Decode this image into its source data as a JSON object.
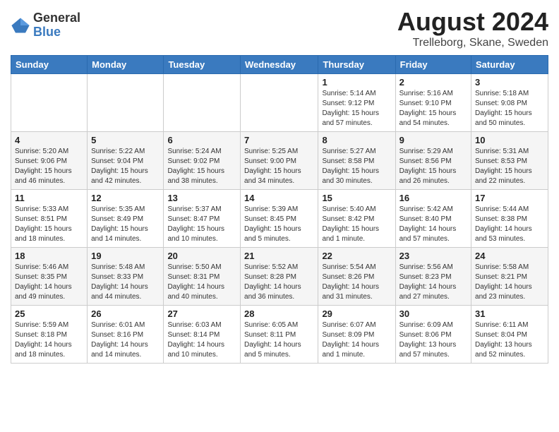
{
  "header": {
    "logo_line1": "General",
    "logo_line2": "Blue",
    "main_title": "August 2024",
    "subtitle": "Trelleborg, Skane, Sweden"
  },
  "calendar": {
    "days_of_week": [
      "Sunday",
      "Monday",
      "Tuesday",
      "Wednesday",
      "Thursday",
      "Friday",
      "Saturday"
    ],
    "weeks": [
      [
        {
          "day": "",
          "info": ""
        },
        {
          "day": "",
          "info": ""
        },
        {
          "day": "",
          "info": ""
        },
        {
          "day": "",
          "info": ""
        },
        {
          "day": "1",
          "info": "Sunrise: 5:14 AM\nSunset: 9:12 PM\nDaylight: 15 hours\nand 57 minutes."
        },
        {
          "day": "2",
          "info": "Sunrise: 5:16 AM\nSunset: 9:10 PM\nDaylight: 15 hours\nand 54 minutes."
        },
        {
          "day": "3",
          "info": "Sunrise: 5:18 AM\nSunset: 9:08 PM\nDaylight: 15 hours\nand 50 minutes."
        }
      ],
      [
        {
          "day": "4",
          "info": "Sunrise: 5:20 AM\nSunset: 9:06 PM\nDaylight: 15 hours\nand 46 minutes."
        },
        {
          "day": "5",
          "info": "Sunrise: 5:22 AM\nSunset: 9:04 PM\nDaylight: 15 hours\nand 42 minutes."
        },
        {
          "day": "6",
          "info": "Sunrise: 5:24 AM\nSunset: 9:02 PM\nDaylight: 15 hours\nand 38 minutes."
        },
        {
          "day": "7",
          "info": "Sunrise: 5:25 AM\nSunset: 9:00 PM\nDaylight: 15 hours\nand 34 minutes."
        },
        {
          "day": "8",
          "info": "Sunrise: 5:27 AM\nSunset: 8:58 PM\nDaylight: 15 hours\nand 30 minutes."
        },
        {
          "day": "9",
          "info": "Sunrise: 5:29 AM\nSunset: 8:56 PM\nDaylight: 15 hours\nand 26 minutes."
        },
        {
          "day": "10",
          "info": "Sunrise: 5:31 AM\nSunset: 8:53 PM\nDaylight: 15 hours\nand 22 minutes."
        }
      ],
      [
        {
          "day": "11",
          "info": "Sunrise: 5:33 AM\nSunset: 8:51 PM\nDaylight: 15 hours\nand 18 minutes."
        },
        {
          "day": "12",
          "info": "Sunrise: 5:35 AM\nSunset: 8:49 PM\nDaylight: 15 hours\nand 14 minutes."
        },
        {
          "day": "13",
          "info": "Sunrise: 5:37 AM\nSunset: 8:47 PM\nDaylight: 15 hours\nand 10 minutes."
        },
        {
          "day": "14",
          "info": "Sunrise: 5:39 AM\nSunset: 8:45 PM\nDaylight: 15 hours\nand 5 minutes."
        },
        {
          "day": "15",
          "info": "Sunrise: 5:40 AM\nSunset: 8:42 PM\nDaylight: 15 hours\nand 1 minute."
        },
        {
          "day": "16",
          "info": "Sunrise: 5:42 AM\nSunset: 8:40 PM\nDaylight: 14 hours\nand 57 minutes."
        },
        {
          "day": "17",
          "info": "Sunrise: 5:44 AM\nSunset: 8:38 PM\nDaylight: 14 hours\nand 53 minutes."
        }
      ],
      [
        {
          "day": "18",
          "info": "Sunrise: 5:46 AM\nSunset: 8:35 PM\nDaylight: 14 hours\nand 49 minutes."
        },
        {
          "day": "19",
          "info": "Sunrise: 5:48 AM\nSunset: 8:33 PM\nDaylight: 14 hours\nand 44 minutes."
        },
        {
          "day": "20",
          "info": "Sunrise: 5:50 AM\nSunset: 8:31 PM\nDaylight: 14 hours\nand 40 minutes."
        },
        {
          "day": "21",
          "info": "Sunrise: 5:52 AM\nSunset: 8:28 PM\nDaylight: 14 hours\nand 36 minutes."
        },
        {
          "day": "22",
          "info": "Sunrise: 5:54 AM\nSunset: 8:26 PM\nDaylight: 14 hours\nand 31 minutes."
        },
        {
          "day": "23",
          "info": "Sunrise: 5:56 AM\nSunset: 8:23 PM\nDaylight: 14 hours\nand 27 minutes."
        },
        {
          "day": "24",
          "info": "Sunrise: 5:58 AM\nSunset: 8:21 PM\nDaylight: 14 hours\nand 23 minutes."
        }
      ],
      [
        {
          "day": "25",
          "info": "Sunrise: 5:59 AM\nSunset: 8:18 PM\nDaylight: 14 hours\nand 18 minutes."
        },
        {
          "day": "26",
          "info": "Sunrise: 6:01 AM\nSunset: 8:16 PM\nDaylight: 14 hours\nand 14 minutes."
        },
        {
          "day": "27",
          "info": "Sunrise: 6:03 AM\nSunset: 8:14 PM\nDaylight: 14 hours\nand 10 minutes."
        },
        {
          "day": "28",
          "info": "Sunrise: 6:05 AM\nSunset: 8:11 PM\nDaylight: 14 hours\nand 5 minutes."
        },
        {
          "day": "29",
          "info": "Sunrise: 6:07 AM\nSunset: 8:09 PM\nDaylight: 14 hours\nand 1 minute."
        },
        {
          "day": "30",
          "info": "Sunrise: 6:09 AM\nSunset: 8:06 PM\nDaylight: 13 hours\nand 57 minutes."
        },
        {
          "day": "31",
          "info": "Sunrise: 6:11 AM\nSunset: 8:04 PM\nDaylight: 13 hours\nand 52 minutes."
        }
      ]
    ]
  }
}
